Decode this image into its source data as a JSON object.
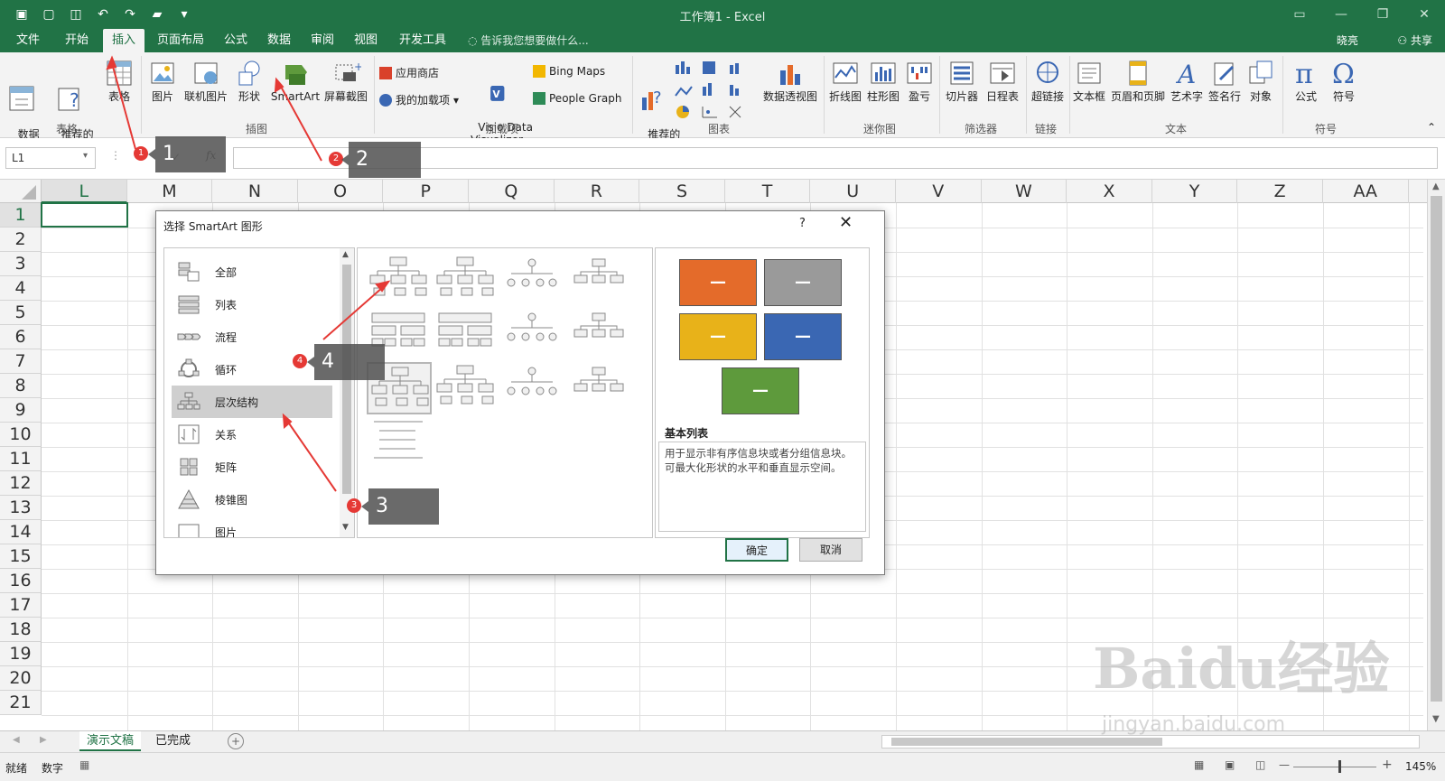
{
  "window": {
    "title": "工作簿1 - Excel"
  },
  "tabs": [
    "文件",
    "开始",
    "插入",
    "页面布局",
    "公式",
    "数据",
    "审阅",
    "视图",
    "开发工具"
  ],
  "active_tab_index": 2,
  "tellme": "告诉我您想要做什么...",
  "user": "晓亮",
  "share": "共享",
  "ribbon": {
    "pivot": "数据\n透视表",
    "recommended_pivot": "推荐的\n数据透视表",
    "table": "表格",
    "picture": "图片",
    "online_picture": "联机图片",
    "shapes": "形状",
    "smartart": "SmartArt",
    "screenshot": "屏幕截图",
    "store": "应用商店",
    "my_addins": "我的加载项",
    "bing_maps": "Bing Maps",
    "visio": "Visio Data\nVisualizer",
    "people_graph": "People Graph",
    "recommended_charts": "推荐的\n图表",
    "pivot_chart": "数据透视图",
    "line_spark": "折线图",
    "column_spark": "柱形图",
    "winloss": "盈亏",
    "slicer": "切片器",
    "timeline": "日程表",
    "hyperlink": "超链接",
    "textbox": "文本框",
    "header_footer": "页眉和页脚",
    "wordart": "艺术字",
    "signature": "签名行",
    "object": "对象",
    "equation": "公式",
    "symbol": "符号",
    "groups": [
      "表格",
      "插图",
      "加载项",
      "图表",
      "迷你图",
      "筛选器",
      "链接",
      "文本",
      "符号"
    ]
  },
  "formula": {
    "namebox": "L1",
    "content": ""
  },
  "grid": {
    "columns": [
      "L",
      "M",
      "N",
      "O",
      "P",
      "Q",
      "R",
      "S",
      "T",
      "U",
      "V",
      "W",
      "X",
      "Y",
      "Z",
      "AA"
    ],
    "rows": [
      "1",
      "2",
      "3",
      "4",
      "5",
      "6",
      "7",
      "8",
      "9",
      "10",
      "11",
      "12",
      "13",
      "14",
      "15",
      "16",
      "17",
      "18",
      "19",
      "20",
      "21"
    ]
  },
  "dialog": {
    "title": "选择 SmartArt 图形",
    "help": "?",
    "close": "✕",
    "categories": [
      "全部",
      "列表",
      "流程",
      "循环",
      "层次结构",
      "关系",
      "矩阵",
      "棱锥图",
      "图片"
    ],
    "selected_category_index": 4,
    "preview_title": "基本列表",
    "preview_desc": "用于显示非有序信息块或者分组信息块。可最大化形状的水平和垂直显示空间。",
    "preview_colors": [
      "#e46b2a",
      "#9a9a9a",
      "#e8b219",
      "#3a67b3",
      "#5e9a3c"
    ],
    "preview_dash": "—",
    "ok": "确定",
    "cancel": "取消"
  },
  "callouts": [
    "1",
    "2",
    "3",
    "4"
  ],
  "sheets": [
    "演示文稿",
    "已完成"
  ],
  "status": {
    "ready": "就绪",
    "numbers": "数字",
    "zoom": "145%",
    "zoom_value": 0.55
  },
  "watermark": {
    "main": "Baidu经验",
    "url": "jingyan.baidu.com"
  },
  "colors": {
    "excel_green": "#217346",
    "annotation_red": "#e53935"
  }
}
